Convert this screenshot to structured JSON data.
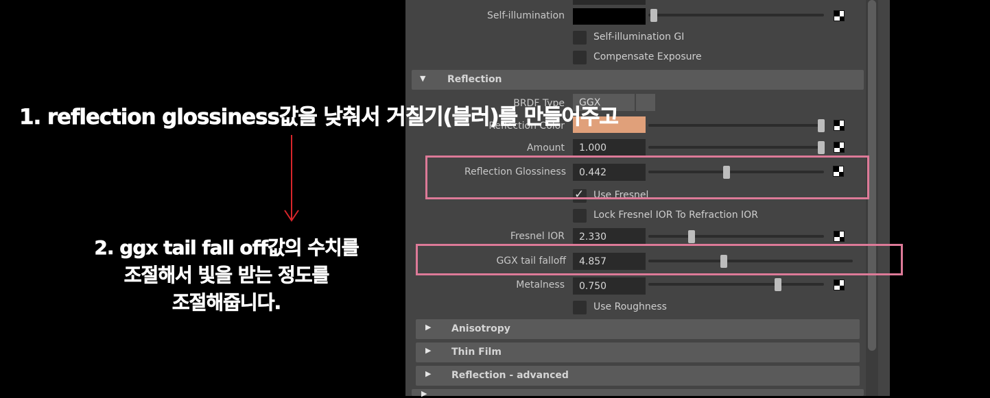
{
  "colors": {
    "background": "#000000",
    "panel": "#444444",
    "highlight_border": "#dd7a98",
    "arrow": "#d8262b",
    "reflection_color_swatch": "#e0a07a"
  },
  "attributes": {
    "self_illumination": {
      "label": "Self-illumination",
      "level": 0.09
    },
    "self_illumination_gi": {
      "label": "Self-illumination GI",
      "checked": false
    },
    "compensate_exposure": {
      "label": "Compensate Exposure",
      "checked": false
    },
    "brdf_type": {
      "label": "BRDF Type",
      "value": "GGX"
    },
    "reflection_color": {
      "label": "Reflection Color",
      "level": 1.0
    },
    "amount": {
      "label": "Amount",
      "value": "1.000",
      "level": 1.0
    },
    "reflection_glossiness": {
      "label": "Reflection Glossiness",
      "value": "0.442",
      "level": 0.442
    },
    "use_fresnel": {
      "label": "Use Fresnel",
      "checked": true
    },
    "lock_fresnel": {
      "label": "Lock Fresnel IOR To Refraction IOR",
      "checked": false
    },
    "fresnel_ior": {
      "label": "Fresnel IOR",
      "value": "2.330",
      "level": 0.26
    },
    "ggx_tail_falloff": {
      "label": "GGX tail falloff",
      "value": "4.857",
      "level": 0.36
    },
    "metalness": {
      "label": "Metalness",
      "value": "0.750",
      "level": 0.75
    },
    "use_roughness": {
      "label": "Use Roughness",
      "checked": false
    }
  },
  "sections": {
    "reflection": "Reflection",
    "anisotropy": "Anisotropy",
    "thin_film": "Thin Film",
    "reflection_advanced": "Reflection - advanced"
  },
  "annotations": {
    "note1": "1. reflection glossiness값을 낮춰서 거칠기(블러)를 만들어주고",
    "note2_line1": "2. ggx tail fall off값의 수치를",
    "note2_line2": "조절해서 빛을 받는 정도를",
    "note2_line3": "조절해줍니다."
  }
}
